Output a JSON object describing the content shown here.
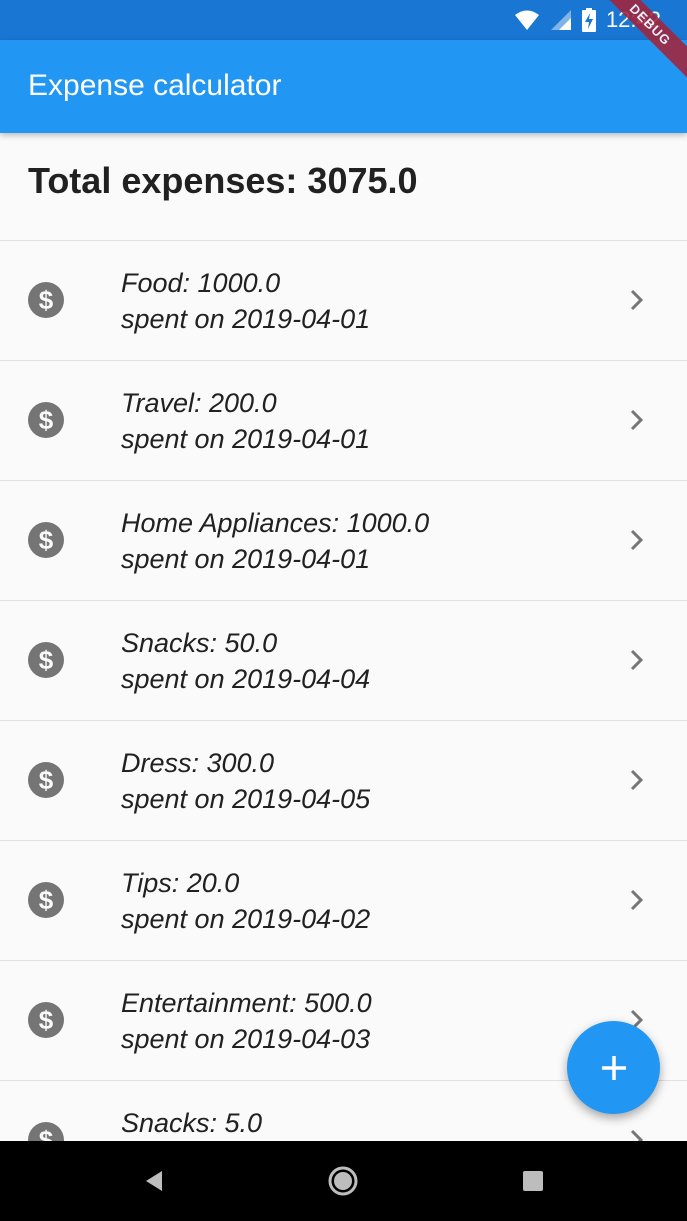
{
  "status_bar": {
    "time": "12:42",
    "icons": [
      "wifi-icon",
      "cell-signal-icon",
      "battery-charging-icon"
    ],
    "debug_label": "DEBUG"
  },
  "app_bar": {
    "title": "Expense calculator"
  },
  "summary": {
    "total_text": "Total expenses: 3075.0"
  },
  "expenses": [
    {
      "title": "Food: 1000.0",
      "subtitle": "spent on 2019-04-01"
    },
    {
      "title": "Travel: 200.0",
      "subtitle": "spent on 2019-04-01"
    },
    {
      "title": "Home Appliances: 1000.0",
      "subtitle": "spent on 2019-04-01"
    },
    {
      "title": "Snacks: 50.0",
      "subtitle": "spent on 2019-04-04"
    },
    {
      "title": "Dress: 300.0",
      "subtitle": "spent on 2019-04-05"
    },
    {
      "title": "Tips: 20.0",
      "subtitle": "spent on 2019-04-02"
    },
    {
      "title": "Entertainment: 500.0",
      "subtitle": "spent on 2019-04-03"
    },
    {
      "title": "Snacks: 5.0",
      "subtitle": ""
    }
  ],
  "list_icons": {
    "leading": "dollar-icon",
    "trailing": "chevron-right-icon"
  },
  "fab": {
    "icon": "plus-icon"
  },
  "nav_bar": {
    "icons": [
      "back-icon",
      "home-icon",
      "recents-icon"
    ]
  },
  "colors": {
    "status_bar": "#1976d2",
    "app_bar": "#2196f3",
    "fab": "#2196f3",
    "background": "#fafafa",
    "icon_grey": "#757575",
    "debug_banner": "#a3243b"
  }
}
